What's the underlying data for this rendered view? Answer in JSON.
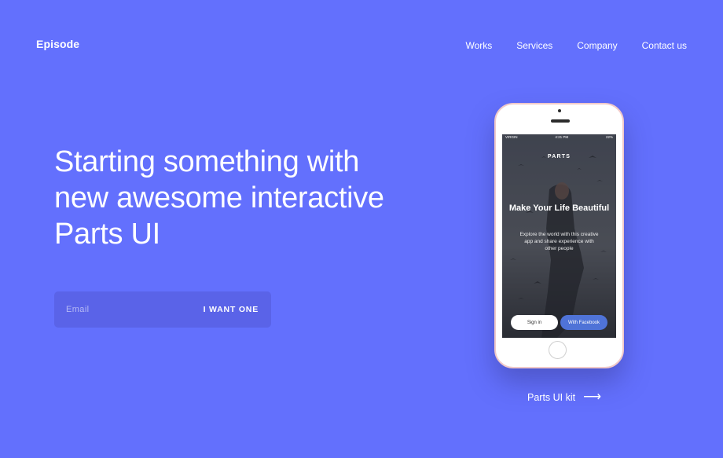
{
  "brand": "Episode",
  "nav": [
    "Works",
    "Services",
    "Company",
    "Contact us"
  ],
  "hero": {
    "headline": "Starting something with new awesome interactive Parts UI",
    "email_placeholder": "Email",
    "cta_label": "I WANT ONE"
  },
  "phone_screen": {
    "carrier": "VIRGIN",
    "time": "4:21 PM",
    "battery": "22%",
    "brand": "PARTS",
    "title": "Make Your Life Beautiful",
    "subtitle": "Explore the world with this creative app and share experience with other people",
    "signin_label": "Sign in",
    "facebook_label": "With Facebook"
  },
  "kit_link": {
    "label": "Parts UI kit",
    "arrow": "⟶"
  },
  "colors": {
    "background": "#6370fd",
    "input_bg": "#5a63e8",
    "facebook": "#4f73d7"
  }
}
